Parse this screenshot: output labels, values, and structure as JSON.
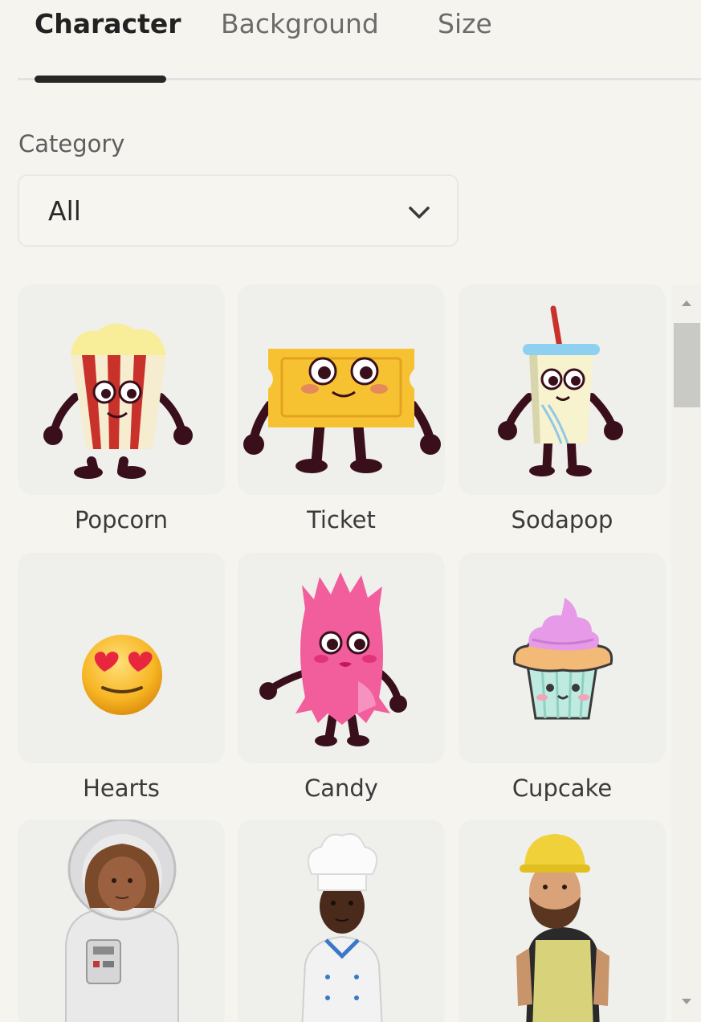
{
  "tabs": [
    {
      "label": "Character",
      "active": true
    },
    {
      "label": "Background",
      "active": false
    },
    {
      "label": "Size",
      "active": false
    }
  ],
  "category": {
    "label": "Category",
    "selected": "All",
    "icon": "chevron-down-icon"
  },
  "characters": [
    {
      "name": "Popcorn"
    },
    {
      "name": "Ticket"
    },
    {
      "name": "Sodapop"
    },
    {
      "name": "Hearts"
    },
    {
      "name": "Candy"
    },
    {
      "name": "Cupcake"
    },
    {
      "name": ""
    },
    {
      "name": ""
    },
    {
      "name": ""
    }
  ],
  "colors": {
    "background": "#f6f4ef",
    "card": "#efefec",
    "tab_indicator": "#262626"
  }
}
